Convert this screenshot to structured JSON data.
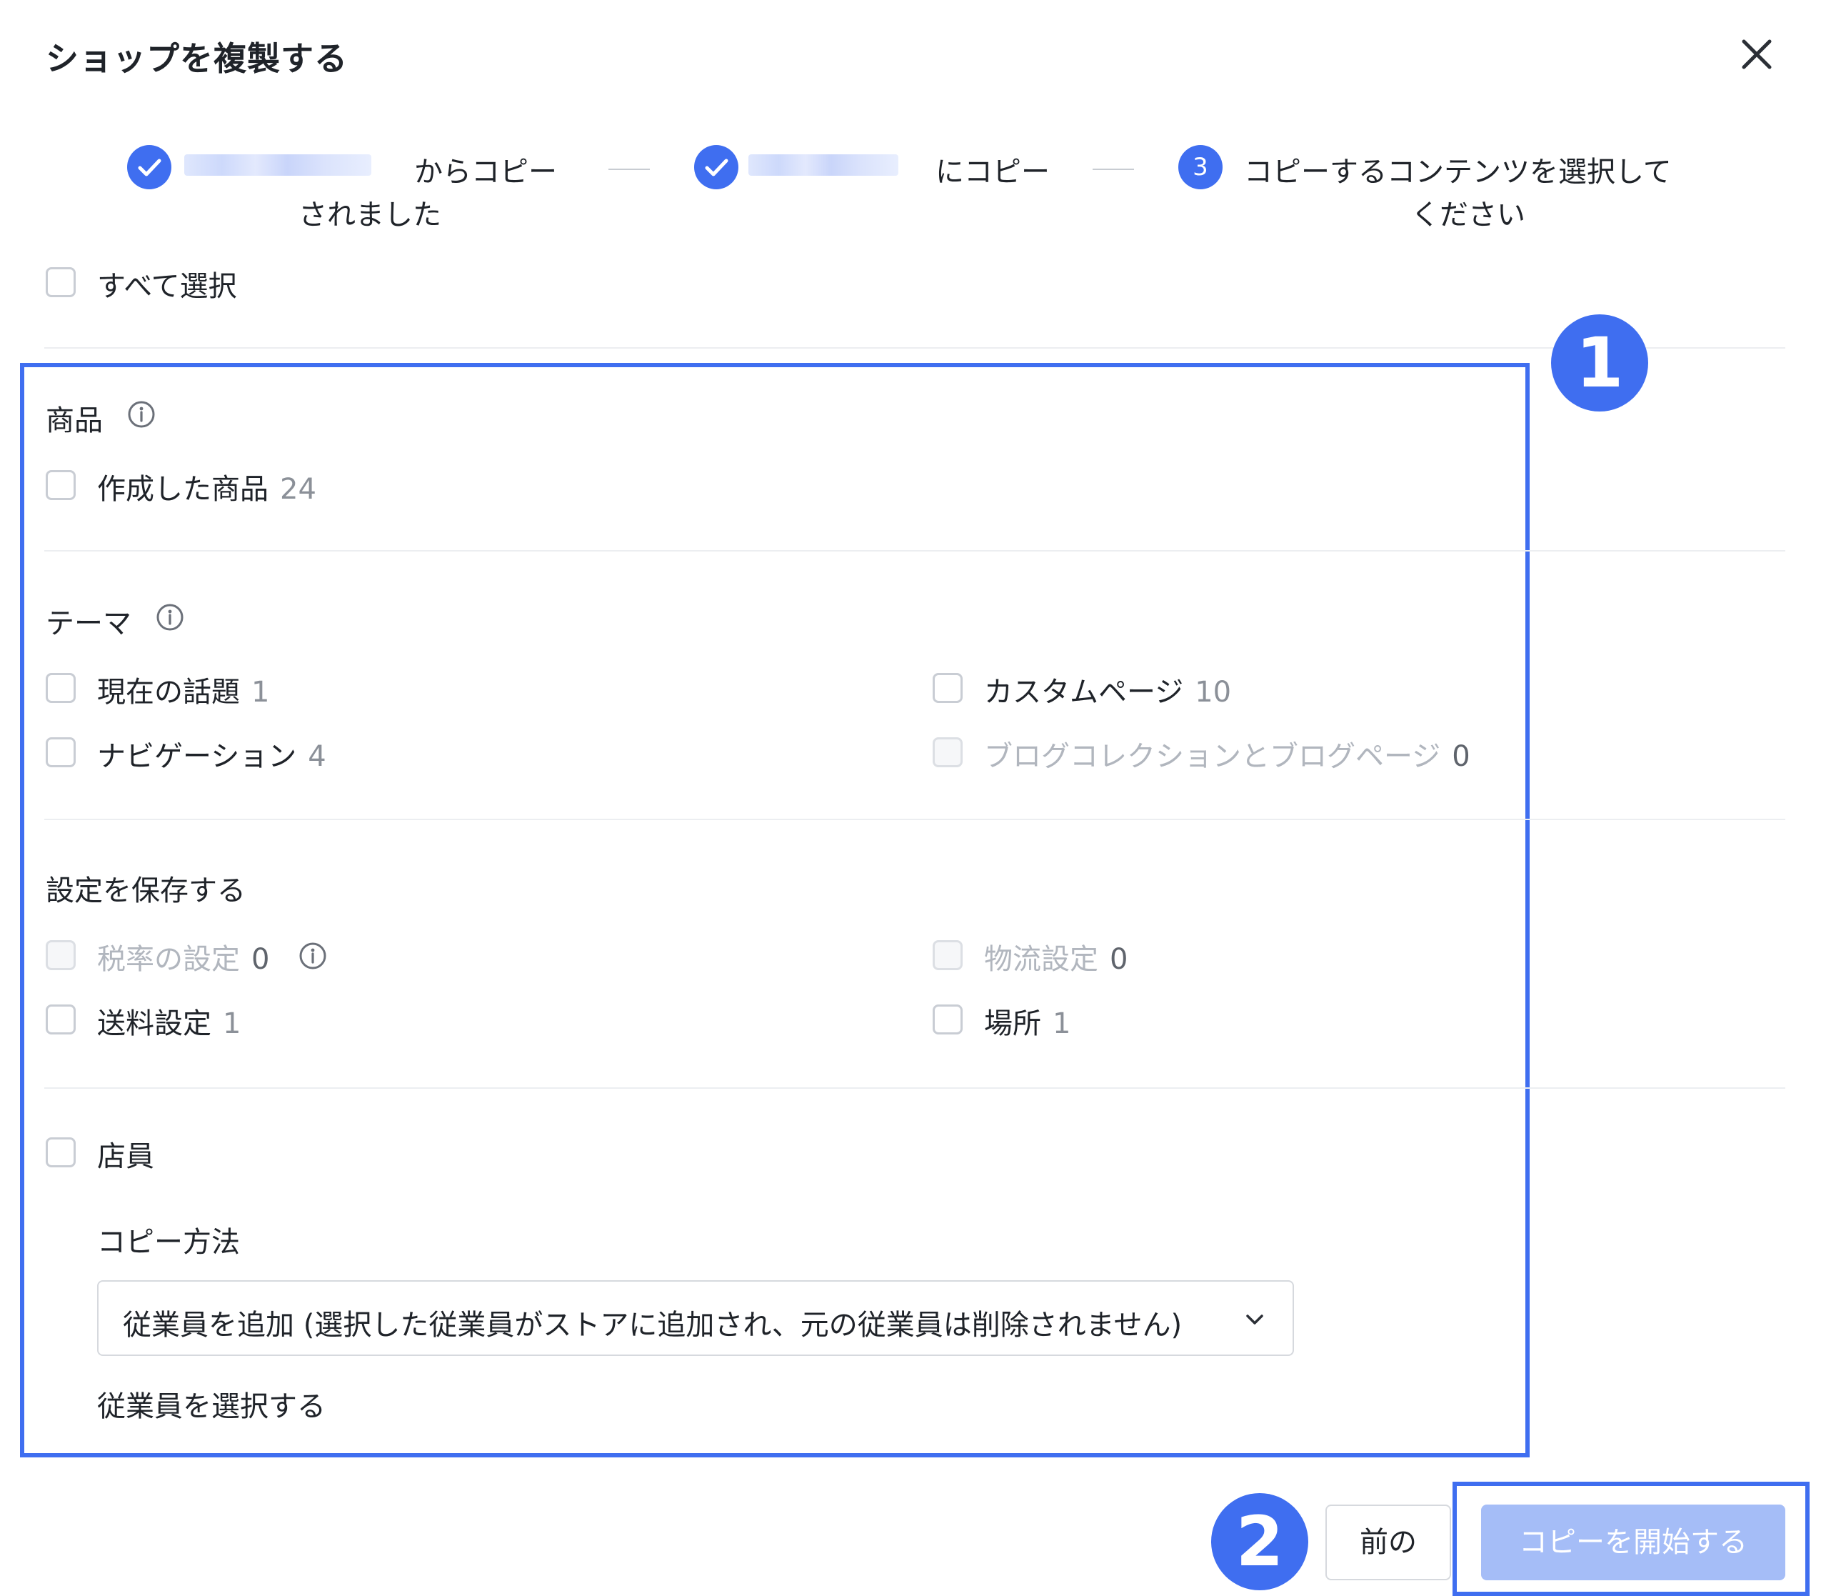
{
  "dialog": {
    "title": "ショップを複製する"
  },
  "steps": [
    {
      "label_line1": "からコピー",
      "label_line2": "されました"
    },
    {
      "label_line1": "にコピー"
    },
    {
      "number": "3",
      "label_line1": "コピーするコンテンツを選択して",
      "label_line2": "ください"
    }
  ],
  "select_all": {
    "label": "すべて選択"
  },
  "sections": {
    "products": {
      "title": "商品",
      "items": [
        {
          "label": "作成した商品",
          "count": "24"
        }
      ]
    },
    "theme": {
      "title": "テーマ",
      "items": [
        {
          "label": "現在の話題",
          "count": "1"
        },
        {
          "label": "カスタムページ",
          "count": "10"
        },
        {
          "label": "ナビゲーション",
          "count": "4"
        },
        {
          "label": "ブログコレクションとブログページ",
          "count": "0"
        }
      ]
    },
    "settings": {
      "title": "設定を保存する",
      "items": [
        {
          "label": "税率の設定",
          "count": "0"
        },
        {
          "label": "物流設定",
          "count": "0"
        },
        {
          "label": "送料設定",
          "count": "1"
        },
        {
          "label": "場所",
          "count": "1"
        }
      ]
    },
    "staff": {
      "title": "店員",
      "copy_method_label": "コピー方法",
      "copy_method_value": "従業員を追加 (選択した従業員がストアに追加され、元の従業員は削除されません)",
      "select_staff_label": "従業員を選択する"
    }
  },
  "annotations": {
    "badge1": "1",
    "badge2": "2"
  },
  "footer": {
    "prev_label": "前の",
    "start_label": "コピーを開始する"
  },
  "colors": {
    "accent": "#3f6ef0",
    "disabled_button": "#a5bdf7",
    "checkbox_border": "#c9cdd4",
    "muted_text": "#8b9098"
  },
  "icons": {
    "close": "close-icon",
    "check": "check-icon",
    "info": "info-icon",
    "chevron": "chevron-down-icon"
  }
}
